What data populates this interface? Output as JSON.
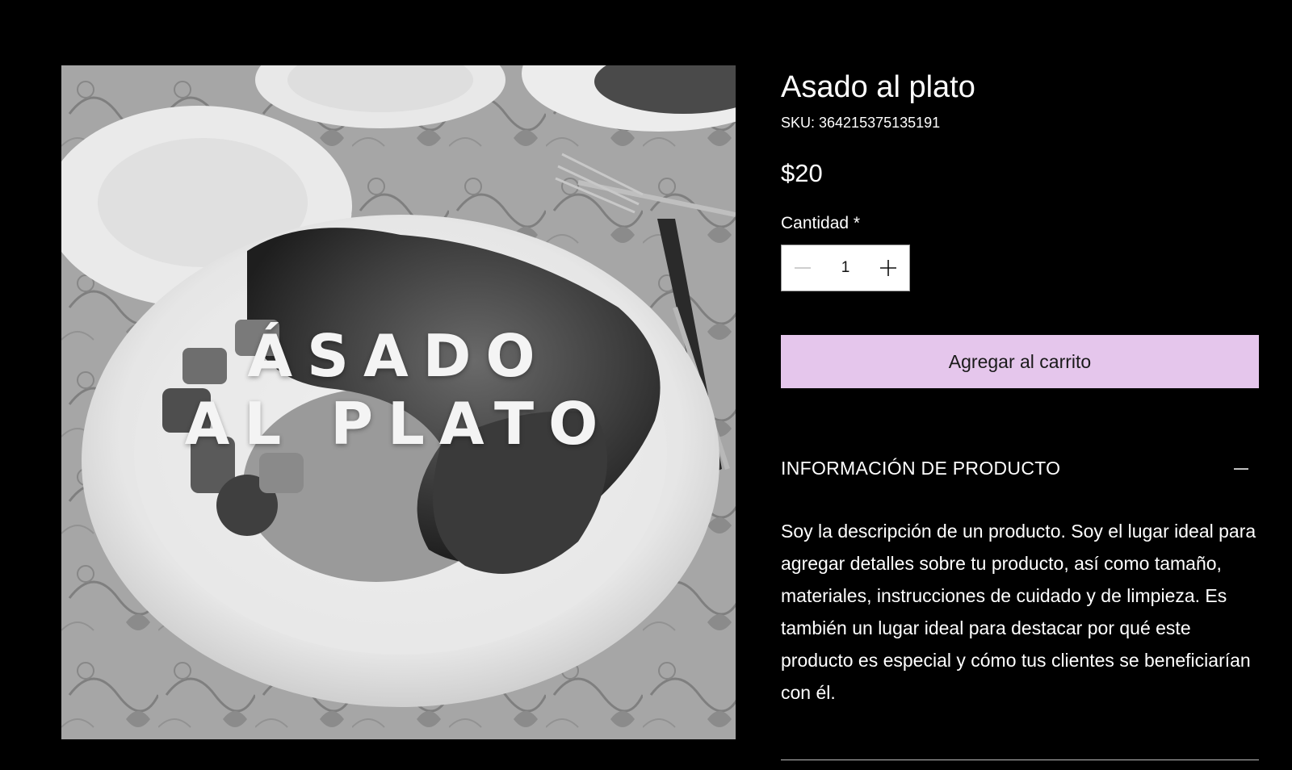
{
  "product": {
    "image_overlay": {
      "line1": "ÁSADO",
      "line2": "AL PLATO"
    },
    "title": "Asado al plato",
    "sku": "SKU: 364215375135191",
    "price": "$20"
  },
  "quantity": {
    "label": "Cantidad *",
    "value": "1",
    "decrement_icon": "minus-icon",
    "increment_icon": "plus-icon"
  },
  "cart": {
    "add_label": "Agregar al carrito",
    "color": "#e5c6ec"
  },
  "info": {
    "title": "INFORMACIÓN DE PRODUCTO",
    "toggle_icon": "minus-icon",
    "description": "Soy la descripción de un producto. Soy el lugar ideal para agregar detalles sobre tu producto, así como tamaño, materiales, instrucciones de cuidado y de limpieza. Es también un lugar ideal para destacar por qué este producto es especial y cómo tus clientes se beneficiarían con él."
  }
}
